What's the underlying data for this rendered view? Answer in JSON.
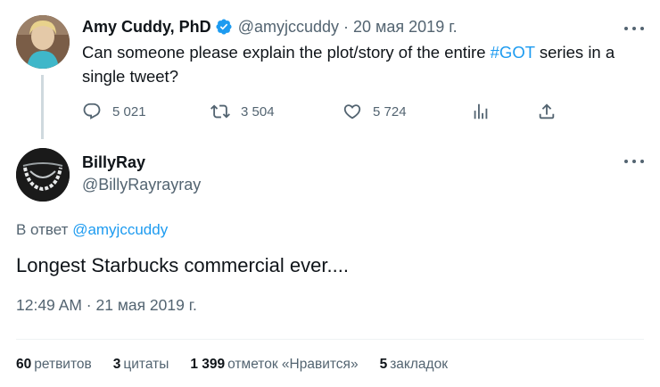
{
  "tweet": {
    "author_name": "Amy Cuddy, PhD",
    "author_handle": "@amyjccuddy",
    "separator": "·",
    "date": "20 мая 2019 г.",
    "text_before": "Can someone please explain the plot/story of the entire ",
    "hashtag": "#GOT",
    "text_after": " series in a single tweet?",
    "replies": "5 021",
    "retweets": "3 504",
    "likes": "5 724",
    "icons": [
      "verified-badge-icon",
      "more-icon",
      "reply-icon",
      "retweet-icon",
      "like-icon",
      "views-icon",
      "share-icon"
    ]
  },
  "reply": {
    "author_name": "BillyRay",
    "author_handle": "@BillyRayrayray",
    "reply_prefix": "В ответ",
    "reply_mention": "@amyjccuddy",
    "text": "Longest Starbucks commercial ever....",
    "timestamp": "12:49 AM · 21 мая 2019 г."
  },
  "stats": [
    {
      "num": "60",
      "label": "ретвитов"
    },
    {
      "num": "3",
      "label": "цитаты"
    },
    {
      "num": "1 399",
      "label": "отметок «Нравится»"
    },
    {
      "num": "5",
      "label": "закладок"
    }
  ],
  "colors": {
    "text": "#0f1419",
    "secondary": "#536471",
    "accent": "#1d9bf0",
    "thread_line": "#cfd9de"
  }
}
